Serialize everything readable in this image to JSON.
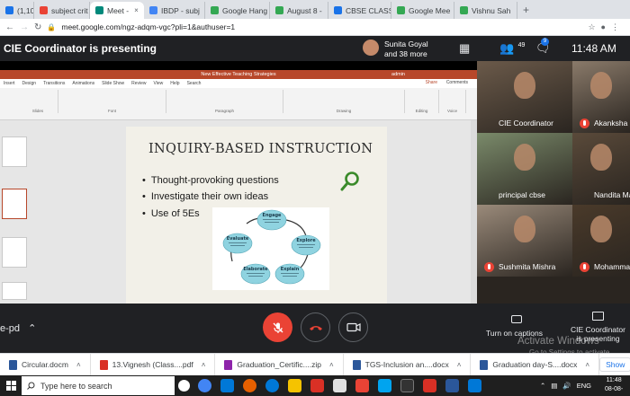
{
  "browser": {
    "tabs": [
      {
        "label": "(1,10",
        "color": "#1a73e8",
        "active": false
      },
      {
        "label": "subject crit",
        "color": "#ea4335",
        "active": false
      },
      {
        "label": "Meet -",
        "color": "#00897b",
        "active": true
      },
      {
        "label": "IBDP - subj",
        "color": "#4285f4",
        "active": false
      },
      {
        "label": "Google Hang",
        "color": "#34a853",
        "active": false
      },
      {
        "label": "August 8 -",
        "color": "#34a853",
        "active": false
      },
      {
        "label": "CBSE CLASS",
        "color": "#1a73e8",
        "active": false
      },
      {
        "label": "Google Mee",
        "color": "#34a853",
        "active": false
      },
      {
        "label": "Vishnu Sah",
        "color": "#34a853",
        "active": false
      }
    ],
    "url": "meet.google.com/ngz-adqm-vgc?pli=1&authuser=1"
  },
  "meet": {
    "presenting_title": "CIE Coordinator is presenting",
    "presenter_name": "Sunita Goyal",
    "presenter_more": "and 38 more",
    "participant_count": "49",
    "chat_badge": "9",
    "clock": "11:48 AM",
    "meeting_code": "e-pd",
    "captions_label": "Turn on captions",
    "presenting_label_1": "CIE Coordinator",
    "presenting_label_2": "is presenting"
  },
  "ppt": {
    "title_bar": "New Effective Teaching Strategies",
    "admin": "admin",
    "share": "Share",
    "comments": "Comments",
    "ribbon_tabs": [
      "Insert",
      "Design",
      "Transitions",
      "Animations",
      "Slide Show",
      "Review",
      "View",
      "Help",
      "Search"
    ],
    "ribbon_groups": [
      "Slides",
      "Font",
      "Paragraph",
      "Drawing",
      "Editing",
      "Voice"
    ]
  },
  "slide": {
    "heading": "INQUIRY-BASED INSTRUCTION",
    "bullets": [
      "Thought-provoking questions",
      "Investigate their own ideas",
      "Use of  5Es"
    ],
    "cycle_labels": [
      "Engage",
      "Explore",
      "Explain",
      "Elaborate",
      "Evaluate"
    ]
  },
  "participants": [
    {
      "name": "CIE Coordinator",
      "muted": false,
      "bg": "#6b5a4a"
    },
    {
      "name": "Akanksha S",
      "muted": true,
      "bg": "#8a7a6a"
    },
    {
      "name": "principal cbse",
      "muted": false,
      "bg": "#7a8a6a"
    },
    {
      "name": "Nandita Ma",
      "muted": false,
      "bg": "#5a4a3a"
    },
    {
      "name": "Sushmita Mishra",
      "muted": true,
      "bg": "#9a8a7a"
    },
    {
      "name": "Mohamma",
      "muted": true,
      "bg": "#4a3a2a"
    }
  ],
  "downloads": [
    {
      "label": "Circular.docm",
      "color": "#2b579a"
    },
    {
      "label": "13.Vignesh (Class....pdf",
      "color": "#d93025"
    },
    {
      "label": "Graduation_Certific....zip",
      "color": "#8e24aa"
    },
    {
      "label": "TGS-Inclusion an....docx",
      "color": "#2b579a"
    },
    {
      "label": "Graduation day-S....docx",
      "color": "#2b579a"
    }
  ],
  "show_all": "Show",
  "watermark": {
    "line1": "Activate Windows",
    "line2": "Go to Settings to activate Windows."
  },
  "taskbar": {
    "search_placeholder": "Type here to search",
    "lang": "ENG",
    "time": "11:48",
    "date": "08-08-"
  }
}
